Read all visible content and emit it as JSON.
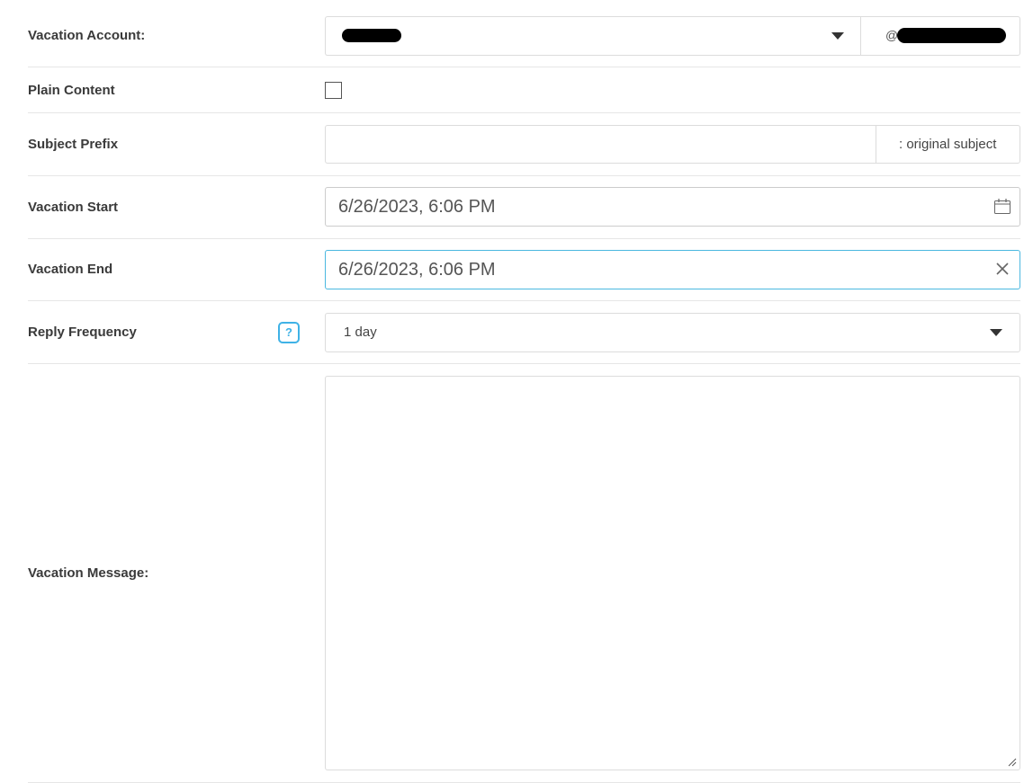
{
  "vacation_account": {
    "label": "Vacation Account:",
    "domain_prefix": "@"
  },
  "plain_content": {
    "label": "Plain Content",
    "checked": false
  },
  "subject_prefix": {
    "label": "Subject Prefix",
    "value": "",
    "addon": ": original subject"
  },
  "vacation_start": {
    "label": "Vacation Start",
    "value": "6/26/2023, 6:06 PM",
    "icon": "calendar-icon"
  },
  "vacation_end": {
    "label": "Vacation End",
    "value": "6/26/2023, 6:06 PM",
    "icon": "close-icon"
  },
  "reply_frequency": {
    "label": "Reply Frequency",
    "help_glyph": "?",
    "selected": "1 day"
  },
  "vacation_message": {
    "label": "Vacation Message:",
    "value": ""
  },
  "colors": {
    "focus_border": "#4bb8e0",
    "help_accent": "#3fb2e6"
  }
}
